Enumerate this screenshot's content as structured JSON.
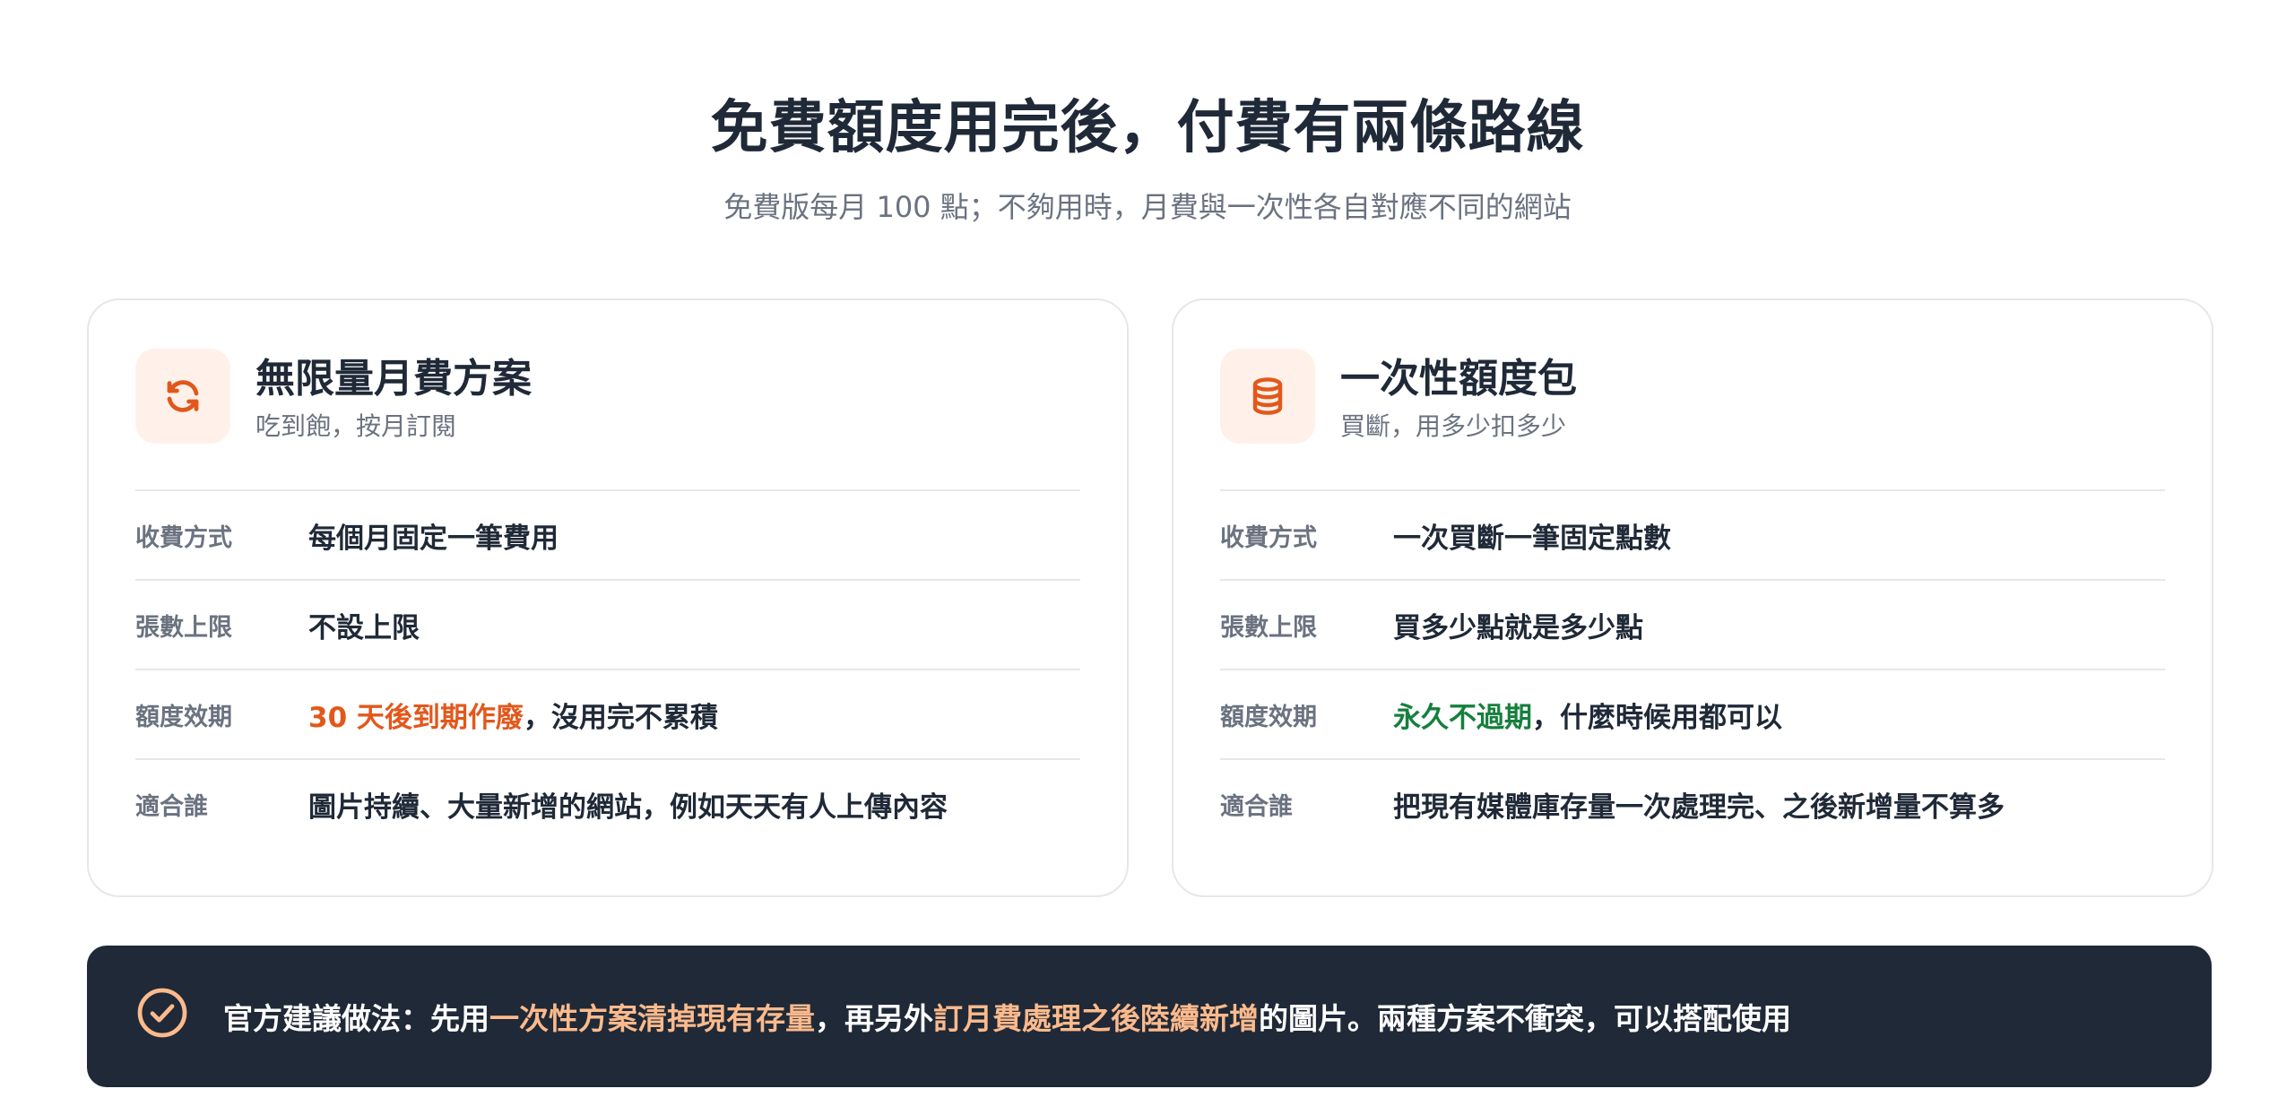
{
  "header": {
    "title": "免費額度用完後，付費有兩條路線",
    "subtitle": "免費版每月 100 點；不夠用時，月費與一次性各自對應不同的網站"
  },
  "colors": {
    "accent": "#e2581c",
    "accent_soft": "#fff1ea",
    "positive": "#15803d",
    "banner_bg": "#1f2937",
    "banner_highlight": "#fdba8c"
  },
  "plans": [
    {
      "icon": "refresh-icon",
      "title": "無限量月費方案",
      "subtitle": "吃到飽，按月訂閱",
      "rows": [
        {
          "label": "收費方式",
          "value": "每個月固定一筆費用"
        },
        {
          "label": "張數上限",
          "value": "不設上限"
        },
        {
          "label": "額度效期",
          "highlight": "30 天後到期作廢",
          "rest": "，沒用完不累積"
        },
        {
          "label": "適合誰",
          "value": "圖片持續、大量新增的網站，例如天天有人上傳內容"
        }
      ]
    },
    {
      "icon": "coins-stack-icon",
      "title": "一次性額度包",
      "subtitle": "買斷，用多少扣多少",
      "rows": [
        {
          "label": "收費方式",
          "value": "一次買斷一筆固定點數"
        },
        {
          "label": "張數上限",
          "value": "買多少點就是多少點"
        },
        {
          "label": "額度效期",
          "highlight": "永久不過期",
          "rest": "，什麼時候用都可以"
        },
        {
          "label": "適合誰",
          "value": "把現有媒體庫存量一次處理完、之後新增量不算多"
        }
      ]
    }
  ],
  "recommendation": {
    "icon": "check-circle-icon",
    "prefix": "官方建議做法：先用",
    "highlight1": "一次性方案清掉現有存量",
    "middle": "，再另外",
    "highlight2": "訂月費處理之後陸續新增",
    "suffix": "的圖片。兩種方案不衝突，可以搭配使用"
  }
}
